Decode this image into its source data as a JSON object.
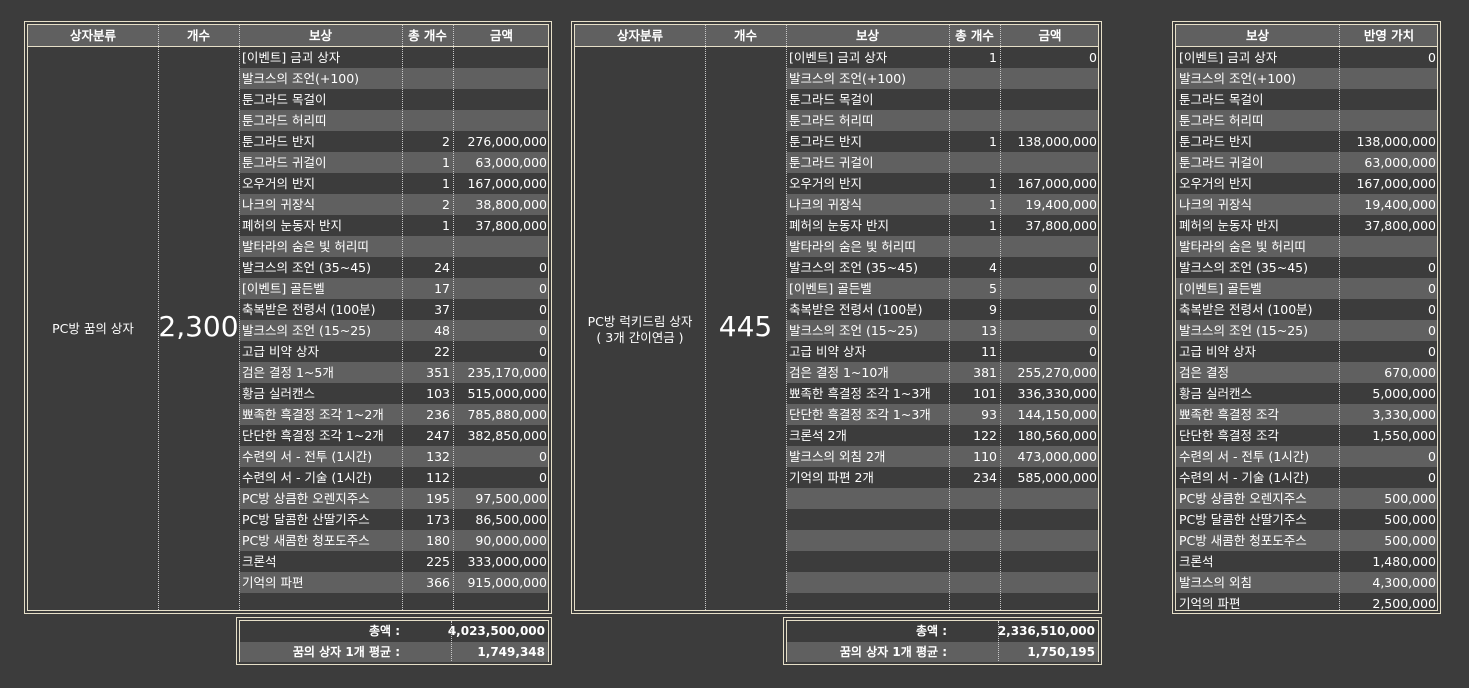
{
  "panel1": {
    "headers": [
      "상자분류",
      "개수",
      "보상",
      "총 개수",
      "금액"
    ],
    "category": "PC방 꿈의 상자",
    "count": "2,300",
    "rows": [
      [
        "[이벤트] 금괴 상자",
        "",
        ""
      ],
      [
        "발크스의 조언(+100)",
        "",
        ""
      ],
      [
        "툰그라드 목걸이",
        "",
        ""
      ],
      [
        "툰그라드 허리띠",
        "",
        ""
      ],
      [
        "툰그라드 반지",
        "2",
        "276,000,000"
      ],
      [
        "툰그라드 귀걸이",
        "1",
        "63,000,000"
      ],
      [
        "오우거의 반지",
        "1",
        "167,000,000"
      ],
      [
        "나크의 귀장식",
        "2",
        "38,800,000"
      ],
      [
        "폐허의 눈동자 반지",
        "1",
        "37,800,000"
      ],
      [
        "발타라의 숨은 빛 허리띠",
        "",
        ""
      ],
      [
        "발크스의 조언 (35~45)",
        "24",
        "0"
      ],
      [
        "[이벤트] 골든벨",
        "17",
        "0"
      ],
      [
        "축복받은 전령서 (100분)",
        "37",
        "0"
      ],
      [
        "발크스의 조언 (15~25)",
        "48",
        "0"
      ],
      [
        "고급 비약 상자",
        "22",
        "0"
      ],
      [
        "검은 결정 1~5개",
        "351",
        "235,170,000"
      ],
      [
        "황금 실러캔스",
        "103",
        "515,000,000"
      ],
      [
        "뾰족한 흑결정 조각 1~2개",
        "236",
        "785,880,000"
      ],
      [
        "단단한 흑결정 조각 1~2개",
        "247",
        "382,850,000"
      ],
      [
        "수련의 서 - 전투 (1시간)",
        "132",
        "0"
      ],
      [
        "수련의 서 - 기술 (1시간)",
        "112",
        "0"
      ],
      [
        "PC방 상큼한 오렌지주스",
        "195",
        "97,500,000"
      ],
      [
        "PC방 달콤한 산딸기주스",
        "173",
        "86,500,000"
      ],
      [
        "PC방 새콤한 청포도주스",
        "180",
        "90,000,000"
      ],
      [
        "크론석",
        "225",
        "333,000,000"
      ],
      [
        "기억의 파편",
        "366",
        "915,000,000"
      ],
      [
        "",
        "",
        ""
      ]
    ],
    "summary": {
      "total_label": "총액 :",
      "total_value": "4,023,500,000",
      "avg_label": "꿈의 상자 1개 평균 :",
      "avg_value": "1,749,348"
    }
  },
  "panel2": {
    "headers": [
      "상자분류",
      "개수",
      "보상",
      "총 개수",
      "금액"
    ],
    "category_line1": "PC방 럭키드림 상자",
    "category_line2": "( 3개 간이연금 )",
    "count": "445",
    "rows": [
      [
        "[이벤트] 금괴 상자",
        "1",
        "0"
      ],
      [
        "발크스의 조언(+100)",
        "",
        ""
      ],
      [
        "툰그라드 목걸이",
        "",
        ""
      ],
      [
        "툰그라드 허리띠",
        "",
        ""
      ],
      [
        "툰그라드 반지",
        "1",
        "138,000,000"
      ],
      [
        "툰그라드 귀걸이",
        "",
        ""
      ],
      [
        "오우거의 반지",
        "1",
        "167,000,000"
      ],
      [
        "나크의 귀장식",
        "1",
        "19,400,000"
      ],
      [
        "폐허의 눈동자 반지",
        "1",
        "37,800,000"
      ],
      [
        "발타라의 숨은 빛 허리띠",
        "",
        ""
      ],
      [
        "발크스의 조언 (35~45)",
        "4",
        "0"
      ],
      [
        "[이벤트] 골든벨",
        "5",
        "0"
      ],
      [
        "축복받은 전령서 (100분)",
        "9",
        "0"
      ],
      [
        "발크스의 조언 (15~25)",
        "13",
        "0"
      ],
      [
        "고급 비약 상자",
        "11",
        "0"
      ],
      [
        "검은 결정 1~10개",
        "381",
        "255,270,000"
      ],
      [
        "뾰족한 흑결정 조각 1~3개",
        "101",
        "336,330,000"
      ],
      [
        "단단한 흑결정 조각 1~3개",
        "93",
        "144,150,000"
      ],
      [
        "크론석 2개",
        "122",
        "180,560,000"
      ],
      [
        "발크스의 외침 2개",
        "110",
        "473,000,000"
      ],
      [
        "기억의 파편 2개",
        "234",
        "585,000,000"
      ],
      [
        "",
        "",
        ""
      ],
      [
        "",
        "",
        ""
      ],
      [
        "",
        "",
        ""
      ],
      [
        "",
        "",
        ""
      ],
      [
        "",
        "",
        ""
      ],
      [
        "",
        "",
        ""
      ]
    ],
    "summary": {
      "total_label": "총액 :",
      "total_value": "2,336,510,000",
      "avg_label": "꿈의 상자 1개 평균 :",
      "avg_value": "1,750,195"
    }
  },
  "panel3": {
    "headers": [
      "보상",
      "반영 가치"
    ],
    "rows": [
      [
        "[이벤트] 금괴 상자",
        "0"
      ],
      [
        "발크스의 조언(+100)",
        ""
      ],
      [
        "툰그라드 목걸이",
        ""
      ],
      [
        "툰그라드 허리띠",
        ""
      ],
      [
        "툰그라드 반지",
        "138,000,000"
      ],
      [
        "툰그라드 귀걸이",
        "63,000,000"
      ],
      [
        "오우거의 반지",
        "167,000,000"
      ],
      [
        "나크의 귀장식",
        "19,400,000"
      ],
      [
        "폐허의 눈동자 반지",
        "37,800,000"
      ],
      [
        "발타라의 숨은 빛 허리띠",
        ""
      ],
      [
        "발크스의 조언 (35~45)",
        "0"
      ],
      [
        "[이벤트] 골든벨",
        "0"
      ],
      [
        "축복받은 전령서 (100분)",
        "0"
      ],
      [
        "발크스의 조언 (15~25)",
        "0"
      ],
      [
        "고급 비약 상자",
        "0"
      ],
      [
        "검은 결정",
        "670,000"
      ],
      [
        "황금 실러캔스",
        "5,000,000"
      ],
      [
        "뾰족한 흑결정 조각",
        "3,330,000"
      ],
      [
        "단단한 흑결정 조각",
        "1,550,000"
      ],
      [
        "수련의 서 - 전투 (1시간)",
        "0"
      ],
      [
        "수련의 서 - 기술 (1시간)",
        "0"
      ],
      [
        "PC방 상큼한 오렌지주스",
        "500,000"
      ],
      [
        "PC방 달콤한 산딸기주스",
        "500,000"
      ],
      [
        "PC방 새콤한 청포도주스",
        "500,000"
      ],
      [
        "크론석",
        "1,480,000"
      ],
      [
        "발크스의 외침",
        "4,300,000"
      ],
      [
        "기억의 파편",
        "2,500,000"
      ]
    ]
  }
}
